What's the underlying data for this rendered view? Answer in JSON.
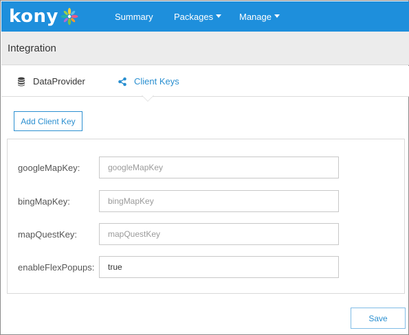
{
  "app": {
    "brand": "kony",
    "logo_icon": "kony-pinwheel-logo"
  },
  "nav": {
    "summary": "Summary",
    "packages": "Packages",
    "manage": "Manage"
  },
  "page": {
    "title": "Integration"
  },
  "tabs": [
    {
      "label": "DataProvider",
      "icon": "database-icon",
      "active": false
    },
    {
      "label": "Client Keys",
      "icon": "share-icon",
      "active": true
    }
  ],
  "actions": {
    "add_client_key": "Add Client Key",
    "save": "Save"
  },
  "form": {
    "fields": [
      {
        "label": "googleMapKey:",
        "value": "",
        "placeholder": "googleMapKey"
      },
      {
        "label": "bingMapKey:",
        "value": "",
        "placeholder": "bingMapKey"
      },
      {
        "label": "mapQuestKey:",
        "value": "",
        "placeholder": "mapQuestKey"
      },
      {
        "label": "enableFlexPopups:",
        "value": "true",
        "placeholder": ""
      }
    ]
  },
  "colors": {
    "topbar": "#1e8fdc",
    "accent": "#2a8fd0",
    "heading_bg": "#ececec"
  }
}
